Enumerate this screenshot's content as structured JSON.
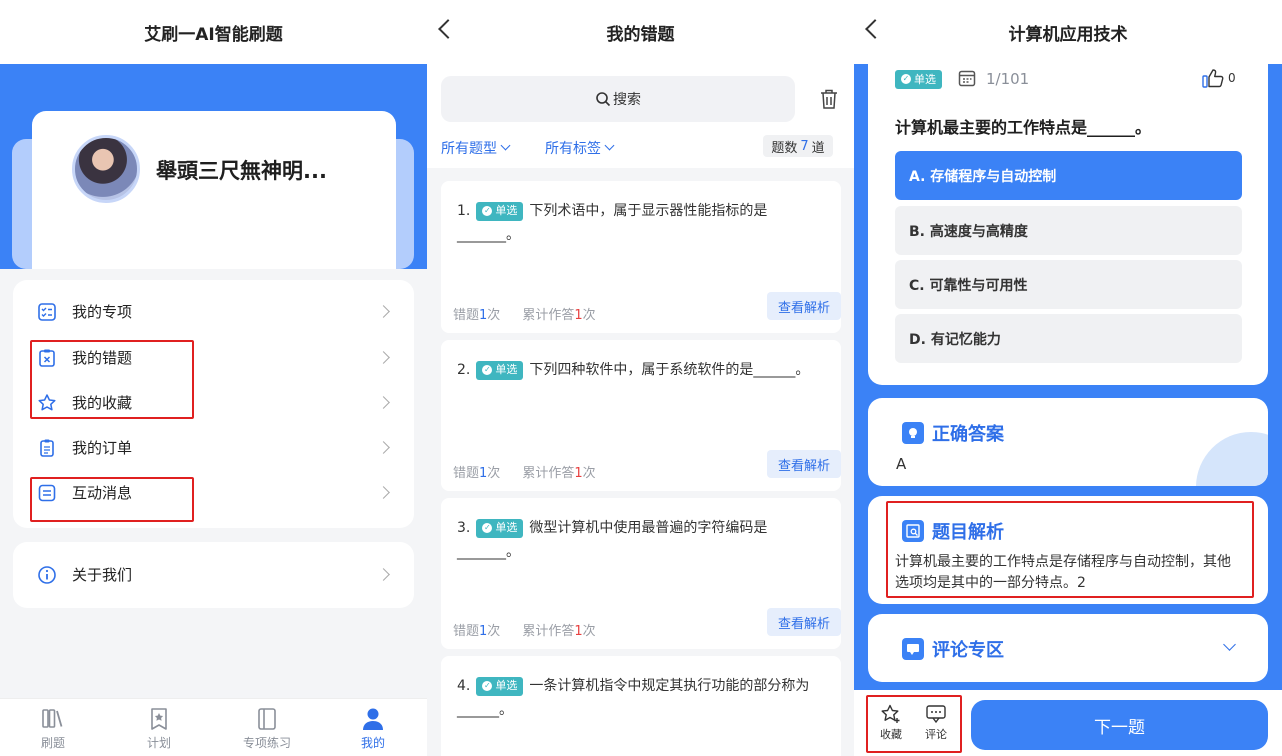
{
  "panel1": {
    "title": "艾刷一AI智能刷题",
    "username": "舉頭三尺無神明...",
    "menu": [
      {
        "label": "我的专项",
        "icon": "list-check-icon"
      },
      {
        "label": "我的错题",
        "icon": "wrong-clipboard-icon"
      },
      {
        "label": "我的收藏",
        "icon": "star-icon"
      },
      {
        "label": "我的订单",
        "icon": "order-clipboard-icon"
      },
      {
        "label": "互动消息",
        "icon": "message-icon"
      }
    ],
    "about": "关于我们",
    "tabs": [
      {
        "label": "刷题",
        "icon": "books-icon"
      },
      {
        "label": "计划",
        "icon": "bookmark-star-icon"
      },
      {
        "label": "专项练习",
        "icon": "notebook-icon"
      },
      {
        "label": "我的",
        "icon": "user-icon"
      }
    ]
  },
  "panel2": {
    "title": "我的错题",
    "search_placeholder": "搜索",
    "filter_type": "所有题型",
    "filter_tag": "所有标签",
    "count_label": "题数",
    "count_value": "7",
    "count_unit": "道",
    "tag_label": "单选",
    "wrong_label": "错题",
    "total_label": "累计作答",
    "times_unit": "次",
    "analysis_label": "查看解析",
    "questions": [
      {
        "num": "1.",
        "text": "下列术语中，属于显示器性能指标的是_______。",
        "wrong": "1",
        "total": "1"
      },
      {
        "num": "2.",
        "text": "下列四种软件中，属于系统软件的是______。",
        "wrong": "1",
        "total": "1"
      },
      {
        "num": "3.",
        "text": "微型计算机中使用最普遍的字符编码是_______。",
        "wrong": "1",
        "total": "1"
      },
      {
        "num": "4.",
        "text": "一条计算机指令中规定其执行功能的部分称为______。"
      }
    ]
  },
  "panel3": {
    "title": "计算机应用技术",
    "tag_label": "单选",
    "progress": "1/101",
    "likes": "0",
    "question": "计算机最主要的工作特点是______。",
    "options": [
      "A. 存储程序与自动控制",
      "B. 高速度与高精度",
      "C. 可靠性与可用性",
      "D. 有记忆能力"
    ],
    "selected_option": 0,
    "answer_title": "正确答案",
    "answer_value": "A",
    "analysis_title": "题目解析",
    "analysis_text": "计算机最主要的工作特点是存储程序与自动控制，其他选项均是其中的一部分特点。2",
    "comment_title": "评论专区",
    "fav_label": "收藏",
    "comment_label": "评论",
    "next_label": "下一题"
  },
  "colors": {
    "accent": "#3b82f6",
    "highlight_box": "#e02020",
    "tag": "#3fb6c0"
  }
}
